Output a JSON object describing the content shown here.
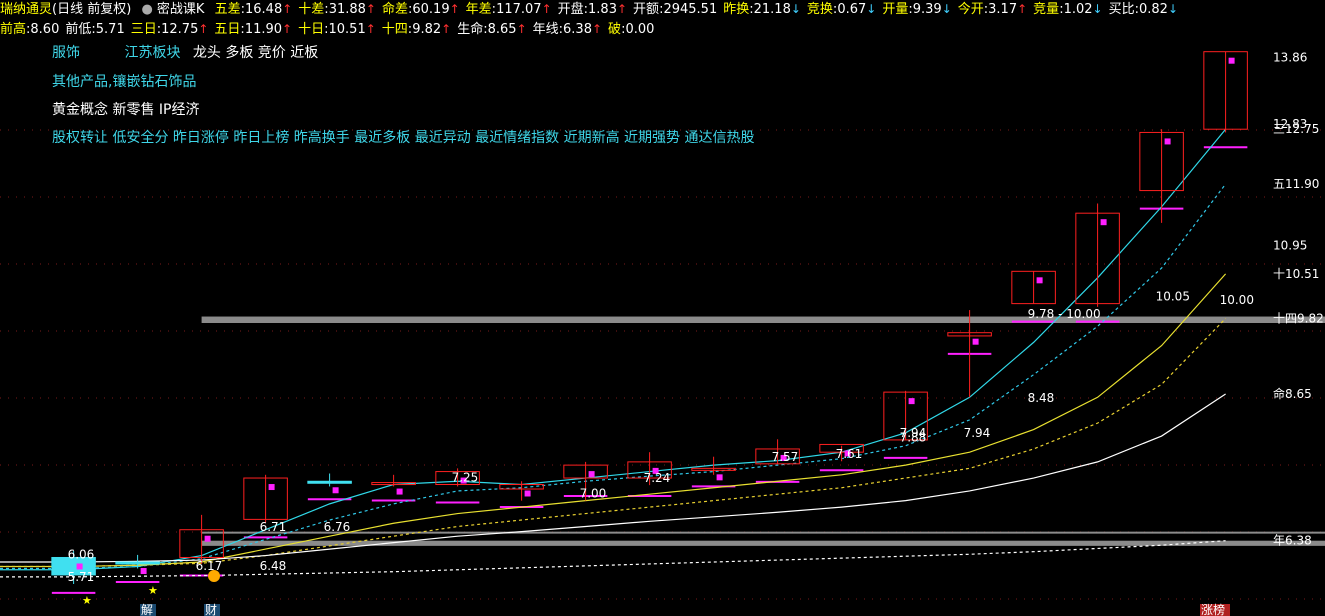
{
  "header": {
    "stock_name": "瑞纳通灵",
    "mode": "(日线 前复权)",
    "indicator_name": "密战课K",
    "row1": [
      {
        "label": "五差",
        "value": "16.48",
        "dir": "up"
      },
      {
        "label": "十差",
        "value": "31.88",
        "dir": "up"
      },
      {
        "label": "命差",
        "value": "60.19",
        "dir": "up"
      },
      {
        "label": "年差",
        "value": "117.07",
        "dir": "up"
      },
      {
        "label": "开盘",
        "value": "1.83",
        "dir": "up"
      },
      {
        "label": "开额",
        "value": "2945.51",
        "dir": ""
      },
      {
        "label": "昨换",
        "value": "21.18",
        "dir": "down"
      },
      {
        "label": "竞换",
        "value": "0.67",
        "dir": "down"
      },
      {
        "label": "开量",
        "value": "9.39",
        "dir": "down"
      },
      {
        "label": "今开",
        "value": "3.17",
        "dir": "up"
      },
      {
        "label": "竞量",
        "value": "1.02",
        "dir": "down"
      },
      {
        "label": "买比",
        "value": "0.82",
        "dir": "down"
      }
    ],
    "row2": [
      {
        "label": "前高",
        "value": "8.60",
        "dir": ""
      },
      {
        "label": "前低",
        "value": "5.71",
        "dir": ""
      },
      {
        "label": "三日",
        "value": "12.75",
        "dir": "up"
      },
      {
        "label": "五日",
        "value": "11.90",
        "dir": "up"
      },
      {
        "label": "十日",
        "value": "10.51",
        "dir": "up"
      },
      {
        "label": "十四",
        "value": "9.82",
        "dir": "up"
      },
      {
        "label": "生命",
        "value": "8.65",
        "dir": "up"
      },
      {
        "label": "年线",
        "value": "6.38",
        "dir": "up"
      },
      {
        "label": "破",
        "value": "0.00",
        "dir": ""
      }
    ]
  },
  "tags": {
    "industry": "服饰",
    "region": "江苏板块",
    "style": "龙头 多板 竞价 近板",
    "product": "其他产品,镶嵌钻石饰品",
    "concepts": "黄金概念 新零售 IP经济",
    "hot": "股权转让 低安全分 昨日涨停 昨日上榜 昨高换手 最近多板 最近异动 最近情绪指数 近期新高 近期强势 通达信热股"
  },
  "colors": {
    "up": "#ff2020",
    "down": "#40e0f0",
    "ma3": "#30d8e8",
    "ma5": "#30c8e8",
    "ma10": "#e8e030",
    "ma14": "#e8d030",
    "life": "#ffffff",
    "year": "#ffffff",
    "magenta": "#ff20ff",
    "zone": "#9a9a9a"
  },
  "chart_data": {
    "type": "candlestick",
    "y_range": [
      5.4,
      14.1
    ],
    "candles": [
      {
        "o": 6.12,
        "h": 6.22,
        "l": 5.71,
        "c": 5.85,
        "dir": "down"
      },
      {
        "o": 6.05,
        "h": 6.16,
        "l": 5.95,
        "c": 6.02,
        "dir": "down"
      },
      {
        "o": 6.12,
        "h": 6.78,
        "l": 6.02,
        "c": 6.55,
        "dir": "up"
      },
      {
        "o": 6.71,
        "h": 7.4,
        "l": 6.66,
        "c": 7.35,
        "dir": "up"
      },
      {
        "o": 7.3,
        "h": 7.42,
        "l": 7.22,
        "c": 7.3,
        "dir": "down"
      },
      {
        "o": 7.28,
        "h": 7.4,
        "l": 7.22,
        "c": 7.28,
        "dir": "up"
      },
      {
        "o": 7.25,
        "h": 7.5,
        "l": 7.22,
        "c": 7.45,
        "dir": "up"
      },
      {
        "o": 7.25,
        "h": 7.3,
        "l": 7.0,
        "c": 7.18,
        "dir": "up"
      },
      {
        "o": 7.35,
        "h": 7.6,
        "l": 7.0,
        "c": 7.55,
        "dir": "up"
      },
      {
        "o": 7.35,
        "h": 7.75,
        "l": 7.24,
        "c": 7.6,
        "dir": "up"
      },
      {
        "o": 7.5,
        "h": 7.68,
        "l": 7.4,
        "c": 7.5,
        "dir": "up"
      },
      {
        "o": 7.57,
        "h": 7.95,
        "l": 7.57,
        "c": 7.8,
        "dir": "up"
      },
      {
        "o": 7.75,
        "h": 7.85,
        "l": 7.61,
        "c": 7.87,
        "dir": "up"
      },
      {
        "o": 7.94,
        "h": 8.7,
        "l": 7.94,
        "c": 8.68,
        "dir": "up"
      },
      {
        "o": 9.6,
        "h": 9.95,
        "l": 8.6,
        "c": 9.55,
        "dir": "up"
      },
      {
        "o": 10.05,
        "h": 10.55,
        "l": 10.05,
        "c": 10.55,
        "dir": "up"
      },
      {
        "o": 10.05,
        "h": 11.6,
        "l": 10.0,
        "c": 11.45,
        "dir": "up"
      },
      {
        "o": 11.8,
        "h": 12.75,
        "l": 11.3,
        "c": 12.7,
        "dir": "up"
      },
      {
        "o": 12.75,
        "h": 13.95,
        "l": 12.7,
        "c": 13.95,
        "dir": "up"
      }
    ],
    "series": [
      {
        "name": "三日",
        "values": [
          5.93,
          5.98,
          6.15,
          6.55,
          6.95,
          7.25,
          7.3,
          7.25,
          7.35,
          7.45,
          7.55,
          7.62,
          7.75,
          8.05,
          8.6,
          9.45,
          10.45,
          11.55,
          12.75
        ],
        "style": "solid"
      },
      {
        "name": "五日",
        "values": [
          5.95,
          5.98,
          6.1,
          6.4,
          6.7,
          6.95,
          7.15,
          7.2,
          7.3,
          7.38,
          7.45,
          7.55,
          7.65,
          7.85,
          8.25,
          8.95,
          9.7,
          10.6,
          11.9
        ],
        "style": "dashed"
      },
      {
        "name": "十日",
        "values": [
          5.98,
          6.0,
          6.05,
          6.25,
          6.45,
          6.65,
          6.8,
          6.9,
          7.0,
          7.1,
          7.2,
          7.3,
          7.4,
          7.55,
          7.75,
          8.1,
          8.6,
          9.4,
          10.51
        ],
        "style": "solid"
      },
      {
        "name": "十四",
        "values": [
          5.98,
          6.0,
          6.03,
          6.15,
          6.3,
          6.45,
          6.6,
          6.7,
          6.8,
          6.9,
          7.0,
          7.1,
          7.2,
          7.35,
          7.5,
          7.8,
          8.2,
          8.8,
          9.82
        ],
        "style": "dashed"
      },
      {
        "name": "生命",
        "values": [
          6.05,
          6.06,
          6.08,
          6.15,
          6.25,
          6.35,
          6.45,
          6.52,
          6.6,
          6.68,
          6.75,
          6.82,
          6.9,
          7.0,
          7.15,
          7.35,
          7.6,
          8.0,
          8.65
        ],
        "style": "solid"
      },
      {
        "name": "年线",
        "values": [
          5.82,
          5.83,
          5.84,
          5.86,
          5.88,
          5.9,
          5.93,
          5.96,
          5.99,
          6.02,
          6.05,
          6.08,
          6.11,
          6.14,
          6.17,
          6.21,
          6.26,
          6.31,
          6.38
        ],
        "style": "dashed"
      }
    ],
    "zones": [
      {
        "y1": 6.3,
        "y2": 6.38
      },
      {
        "y1": 6.5,
        "y2": 6.52
      },
      {
        "y1": 9.75,
        "y2": 9.85
      }
    ],
    "price_labels": [
      {
        "i": 0,
        "price": 6.06,
        "text": "6.06"
      },
      {
        "i": 0,
        "price": 5.71,
        "text": "5.71"
      },
      {
        "i": 2,
        "price": 5.88,
        "text": "6.17"
      },
      {
        "i": 3,
        "price": 5.88,
        "text": "6.48"
      },
      {
        "i": 3,
        "price": 6.48,
        "text": "6.71"
      },
      {
        "i": 4,
        "price": 6.48,
        "text": "6.76"
      },
      {
        "i": 6,
        "price": 7.25,
        "text": "7.25"
      },
      {
        "i": 8,
        "price": 7.0,
        "text": "7.00"
      },
      {
        "i": 9,
        "price": 7.24,
        "text": "7.24"
      },
      {
        "i": 11,
        "price": 7.57,
        "text": "7.57"
      },
      {
        "i": 12,
        "price": 7.61,
        "text": "7.61"
      },
      {
        "i": 13,
        "price": 7.94,
        "text": "7.94"
      },
      {
        "i": 13,
        "price": 7.87,
        "text": "7.88"
      },
      {
        "i": 14,
        "price": 7.94,
        "text": "7.94"
      },
      {
        "i": 15,
        "price": 8.48,
        "text": "8.48"
      },
      {
        "i": 15,
        "price": 9.78,
        "text": "9.78 - 10.00"
      },
      {
        "i": 17,
        "price": 10.05,
        "text": "10.05"
      },
      {
        "i": 18,
        "price": 10.0,
        "text": "10.00"
      }
    ],
    "right_labels": [
      {
        "price": 13.86,
        "text": "13.86"
      },
      {
        "price": 12.75,
        "text": "三12.75"
      },
      {
        "price": 12.83,
        "text": "12.83"
      },
      {
        "price": 11.9,
        "text": "五11.90"
      },
      {
        "price": 10.95,
        "text": "10.95"
      },
      {
        "price": 10.51,
        "text": "十10.51"
      },
      {
        "price": 9.82,
        "text": "十四9.82"
      },
      {
        "price": 8.65,
        "text": "命8.65"
      },
      {
        "price": 6.38,
        "text": "年6.38"
      }
    ],
    "bottom_markers": [
      "解",
      "财",
      "涨榜"
    ]
  }
}
